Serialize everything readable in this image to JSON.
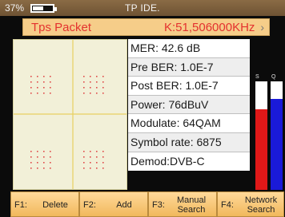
{
  "status": {
    "battery_percent": "37%",
    "battery_level": 0.5,
    "title": "TP IDE."
  },
  "header": {
    "label": "Tps Packet",
    "frequency": "K:51,506000KHz",
    "arrow_icon": "chevron-right-icon"
  },
  "readouts": [
    "MER: 42.6 dB",
    "Pre BER: 1.0E-7",
    "Post BER: 1.0E-7",
    "Power: 76dBuV",
    "Modulate: 64QAM",
    "Symbol rate: 6875",
    "Demod:DVB-C"
  ],
  "meters": {
    "s_label": "S",
    "q_label": "Q",
    "s_level": 0.74,
    "q_level": 0.84,
    "s_color": "#e01818",
    "q_color": "#1a1ad8"
  },
  "constellation": {
    "modulation": "64QAM",
    "dot_color": "#e04a4a",
    "axis_color": "#e8d060"
  },
  "fkeys": [
    {
      "num": "F1:",
      "label": "Delete"
    },
    {
      "num": "F2:",
      "label": "Add"
    },
    {
      "num": "F3:",
      "label": "Manual Search"
    },
    {
      "num": "F4:",
      "label": "Network Search"
    }
  ],
  "colors": {
    "header_bg": "#f6cd89",
    "header_text": "#e3322f",
    "statusbar": "#7d5e3c"
  }
}
